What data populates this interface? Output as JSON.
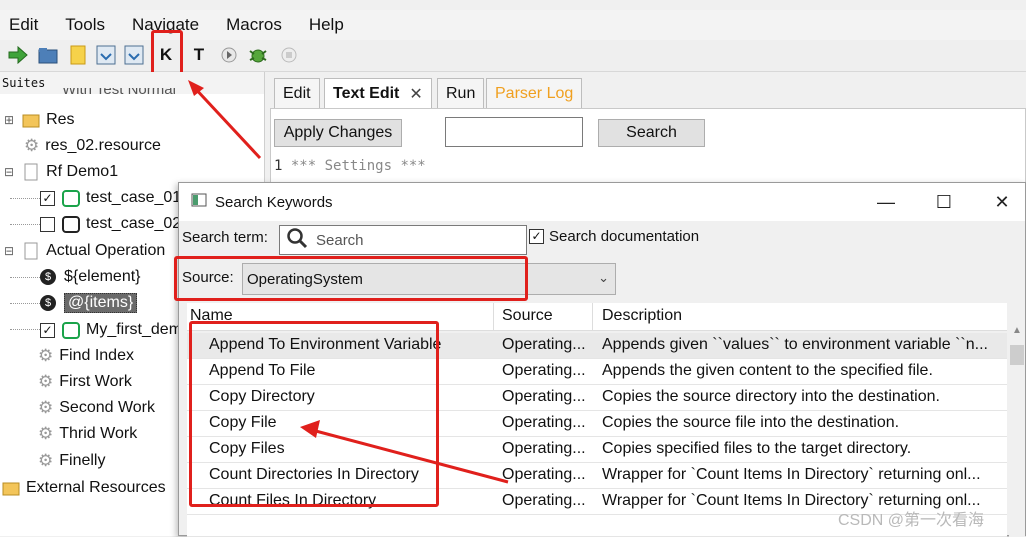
{
  "menubar": {
    "items": [
      "Edit",
      "Tools",
      "Navigate",
      "Macros",
      "Help"
    ]
  },
  "toolbar": {
    "highlighted_icon_label": "K",
    "next_icon_label": "T"
  },
  "tree": {
    "header": "Suites",
    "top_cut": "With Test Normal",
    "nodes": [
      {
        "label": "Res"
      },
      {
        "label": "res_02.resource"
      },
      {
        "label": "Rf Demo1"
      },
      {
        "label": "test_case_01"
      },
      {
        "label": "test_case_02"
      },
      {
        "label": "Actual Operation"
      },
      {
        "label": "${element}"
      },
      {
        "label": "@{items}"
      },
      {
        "label": "My_first_demo"
      },
      {
        "label": "Find Index"
      },
      {
        "label": "First Work"
      },
      {
        "label": "Second Work"
      },
      {
        "label": "Thrid Work"
      },
      {
        "label": "Finelly"
      },
      {
        "label": "External Resources"
      }
    ]
  },
  "editor": {
    "tabs": [
      "Edit",
      "Text Edit",
      "Run",
      "Parser Log"
    ],
    "apply_label": "Apply Changes",
    "search_label": "Search",
    "line_number": "1",
    "code": "*** Settings ***"
  },
  "dialog": {
    "title": "Search Keywords",
    "search_term_label": "Search term:",
    "search_placeholder": "Search",
    "search_doc_label": "Search documentation",
    "source_label": "Source:",
    "source_value": "OperatingSystem",
    "columns": [
      "Name",
      "Source",
      "Description"
    ],
    "rows": [
      {
        "name": "Append To Environment Variable",
        "source": "Operating...",
        "desc": "Appends given ``values`` to environment variable ``n..."
      },
      {
        "name": "Append To File",
        "source": "Operating...",
        "desc": "Appends the given content to the specified file."
      },
      {
        "name": "Copy Directory",
        "source": "Operating...",
        "desc": "Copies the source directory into the destination."
      },
      {
        "name": "Copy File",
        "source": "Operating...",
        "desc": "Copies the source file into the destination."
      },
      {
        "name": "Copy Files",
        "source": "Operating...",
        "desc": "Copies specified files to the target directory."
      },
      {
        "name": "Count Directories In Directory",
        "source": "Operating...",
        "desc": "Wrapper for `Count Items In Directory` returning onl..."
      },
      {
        "name": "Count Files In Directory",
        "source": "Operating...",
        "desc": "Wrapper for `Count Items In Directory` returning onl..."
      }
    ]
  },
  "watermark": "CSDN @第一次看海",
  "colors": {
    "annotation_red": "#e0201c",
    "parser_log_tab": "#f0a020",
    "testcase_green": "#1aa34a"
  }
}
